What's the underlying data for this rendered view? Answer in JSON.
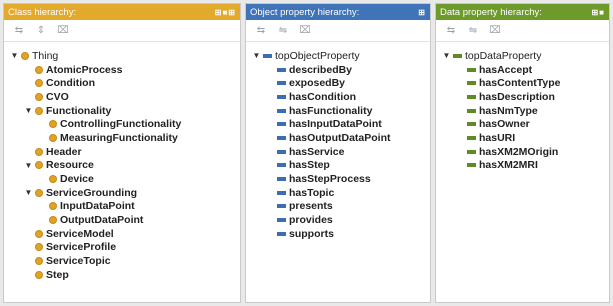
{
  "class_panel": {
    "title": "Class hierarchy:",
    "title_bg": "#e3a92c",
    "controls": "⊞■⊞",
    "toolbar": [
      {
        "name": "add-subclass-button",
        "glyph": "⇆"
      },
      {
        "name": "add-sibling-button",
        "glyph": "⇕"
      },
      {
        "name": "delete-class-button",
        "glyph": "⌧"
      }
    ],
    "tree": [
      {
        "label": "Thing",
        "level": 0,
        "toggle": "▼",
        "bold": false
      },
      {
        "label": "AtomicProcess",
        "level": 1,
        "toggle": "",
        "bold": true
      },
      {
        "label": "Condition",
        "level": 1,
        "toggle": "",
        "bold": true
      },
      {
        "label": "CVO",
        "level": 1,
        "toggle": "",
        "bold": true
      },
      {
        "label": "Functionality",
        "level": 1,
        "toggle": "▼",
        "bold": true
      },
      {
        "label": "ControllingFunctionality",
        "level": 2,
        "toggle": "",
        "bold": true
      },
      {
        "label": "MeasuringFunctionality",
        "level": 2,
        "toggle": "",
        "bold": true
      },
      {
        "label": "Header",
        "level": 1,
        "toggle": "",
        "bold": true
      },
      {
        "label": "Resource",
        "level": 1,
        "toggle": "▼",
        "bold": true
      },
      {
        "label": "Device",
        "level": 2,
        "toggle": "",
        "bold": true
      },
      {
        "label": "ServiceGrounding",
        "level": 1,
        "toggle": "▼",
        "bold": true
      },
      {
        "label": "InputDataPoint",
        "level": 2,
        "toggle": "",
        "bold": true
      },
      {
        "label": "OutputDataPoint",
        "level": 2,
        "toggle": "",
        "bold": true
      },
      {
        "label": "ServiceModel",
        "level": 1,
        "toggle": "",
        "bold": true
      },
      {
        "label": "ServiceProfile",
        "level": 1,
        "toggle": "",
        "bold": true
      },
      {
        "label": "ServiceTopic",
        "level": 1,
        "toggle": "",
        "bold": true
      },
      {
        "label": "Step",
        "level": 1,
        "toggle": "",
        "bold": true
      }
    ]
  },
  "object_panel": {
    "title": "Object property hierarchy:",
    "title_bg": "#3f74b8",
    "controls": "⊞",
    "toolbar": [
      {
        "name": "add-subproperty-button",
        "glyph": "⇆"
      },
      {
        "name": "add-sibling-property-button",
        "glyph": "⇋"
      },
      {
        "name": "delete-property-button",
        "glyph": "⌧"
      }
    ],
    "tree": [
      {
        "label": "topObjectProperty",
        "level": 0,
        "toggle": "▼",
        "bold": false
      },
      {
        "label": "describedBy",
        "level": 1,
        "toggle": "",
        "bold": true
      },
      {
        "label": "exposedBy",
        "level": 1,
        "toggle": "",
        "bold": true
      },
      {
        "label": "hasCondition",
        "level": 1,
        "toggle": "",
        "bold": true
      },
      {
        "label": "hasFunctionality",
        "level": 1,
        "toggle": "",
        "bold": true
      },
      {
        "label": "hasInputDataPoint",
        "level": 1,
        "toggle": "",
        "bold": true
      },
      {
        "label": "hasOutputDataPoint",
        "level": 1,
        "toggle": "",
        "bold": true
      },
      {
        "label": "hasService",
        "level": 1,
        "toggle": "",
        "bold": true
      },
      {
        "label": "hasStep",
        "level": 1,
        "toggle": "",
        "bold": true
      },
      {
        "label": "hasStepProcess",
        "level": 1,
        "toggle": "",
        "bold": true
      },
      {
        "label": "hasTopic",
        "level": 1,
        "toggle": "",
        "bold": true
      },
      {
        "label": "presents",
        "level": 1,
        "toggle": "",
        "bold": true
      },
      {
        "label": "provides",
        "level": 1,
        "toggle": "",
        "bold": true
      },
      {
        "label": "supports",
        "level": 1,
        "toggle": "",
        "bold": true
      }
    ]
  },
  "data_panel": {
    "title": "Data property hierarchy:",
    "title_bg": "#6d9a2b",
    "controls": "⊞■",
    "toolbar": [
      {
        "name": "add-data-subproperty-button",
        "glyph": "⇆"
      },
      {
        "name": "add-data-sibling-button",
        "glyph": "⇋"
      },
      {
        "name": "delete-data-property-button",
        "glyph": "⌧"
      }
    ],
    "tree": [
      {
        "label": "topDataProperty",
        "level": 0,
        "toggle": "▼",
        "bold": false
      },
      {
        "label": "hasAccept",
        "level": 1,
        "toggle": "",
        "bold": true
      },
      {
        "label": "hasContentType",
        "level": 1,
        "toggle": "",
        "bold": true
      },
      {
        "label": "hasDescription",
        "level": 1,
        "toggle": "",
        "bold": true
      },
      {
        "label": "hasNmType",
        "level": 1,
        "toggle": "",
        "bold": true
      },
      {
        "label": "hasOwner",
        "level": 1,
        "toggle": "",
        "bold": true
      },
      {
        "label": "hasURI",
        "level": 1,
        "toggle": "",
        "bold": true
      },
      {
        "label": "hasXM2MOrigin",
        "level": 1,
        "toggle": "",
        "bold": true
      },
      {
        "label": "hasXM2MRI",
        "level": 1,
        "toggle": "",
        "bold": true
      }
    ]
  }
}
